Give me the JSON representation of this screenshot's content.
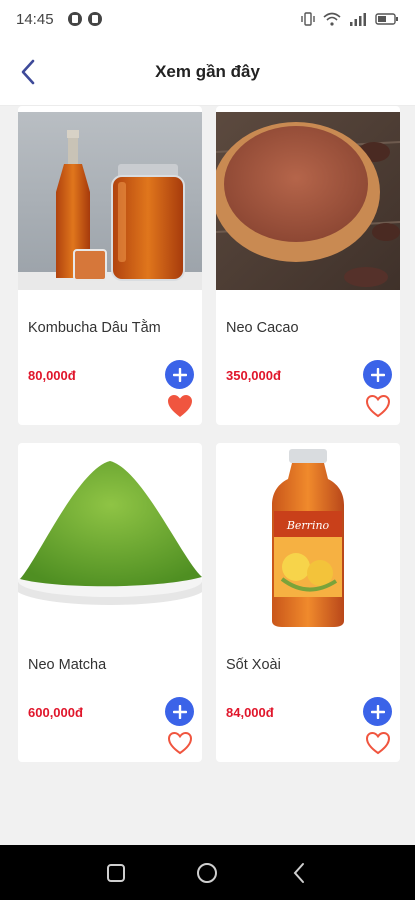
{
  "status_bar": {
    "time": "14:45",
    "left_icons": [
      "app-notification-icon",
      "app-notification-icon"
    ],
    "right_icons": [
      "vibrate-icon",
      "wifi-icon",
      "signal-icon",
      "battery-icon"
    ]
  },
  "header": {
    "title": "Xem gần đây",
    "back_icon": "chevron-left-icon"
  },
  "products": [
    {
      "name": "Kombucha Dâu Tằm",
      "price": "80,000đ",
      "favorited": true
    },
    {
      "name": "Neo Cacao",
      "price": "350,000đ",
      "favorited": false
    },
    {
      "name": "Neo Matcha",
      "price": "600,000đ",
      "favorited": false
    },
    {
      "name": "Sốt Xoài",
      "price": "84,000đ",
      "favorited": false
    }
  ],
  "bottle_label": "Berrino",
  "colors": {
    "accent_blue": "#3b63e8",
    "price_red": "#e0162b",
    "heart_orange": "#f0553f"
  },
  "nav_bar": {
    "buttons": [
      "recent-apps-icon",
      "home-icon",
      "back-icon"
    ]
  }
}
